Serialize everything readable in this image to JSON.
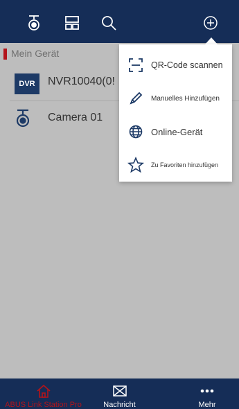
{
  "header": {
    "icons": [
      "camera-icon",
      "layout-icon",
      "search-icon",
      "add-icon"
    ]
  },
  "section": {
    "title": "Mein Gerät"
  },
  "devices": [
    {
      "badge": "DVR",
      "name": "NVR10040(0!",
      "icon": "dvr-badge"
    },
    {
      "name": "Camera 01",
      "icon": "camera-icon"
    }
  ],
  "popup_menu": {
    "items": [
      {
        "label": "QR-Code scannen",
        "icon": "qr-scan-icon"
      },
      {
        "label": "Manuelles Hinzufügen",
        "icon": "pencil-icon"
      },
      {
        "label": "Online-Gerät",
        "icon": "globe-icon"
      },
      {
        "label": "Zu Favoriten hinzufügen",
        "icon": "star-icon"
      }
    ]
  },
  "tabs": [
    {
      "label": "ABUS Link Station Pro",
      "icon": "home-icon",
      "active": true
    },
    {
      "label": "Nachricht",
      "icon": "envelope-icon",
      "active": false
    },
    {
      "label": "Mehr",
      "icon": "more-icon",
      "active": false
    }
  ],
  "colors": {
    "header_bg": "#152d57",
    "accent_red": "#b3141a",
    "content_bg": "#bdbdbd"
  }
}
